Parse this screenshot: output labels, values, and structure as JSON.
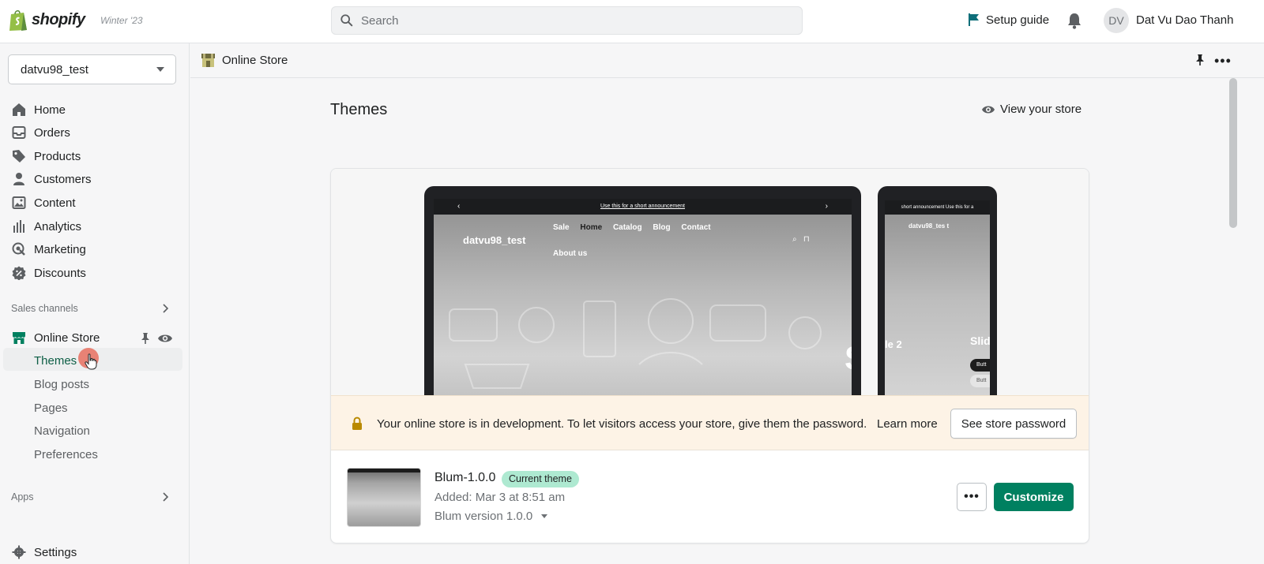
{
  "topbar": {
    "brand": "shopify",
    "edition": "Winter '23",
    "search_placeholder": "Search",
    "setup_guide": "Setup guide",
    "avatar_initials": "DV",
    "user_name": "Dat Vu Dao Thanh"
  },
  "sidebar": {
    "store": "datvu98_test",
    "items": [
      {
        "label": "Home",
        "icon": "home-icon"
      },
      {
        "label": "Orders",
        "icon": "orders-icon"
      },
      {
        "label": "Products",
        "icon": "tag-icon"
      },
      {
        "label": "Customers",
        "icon": "person-icon"
      },
      {
        "label": "Content",
        "icon": "image-icon"
      },
      {
        "label": "Analytics",
        "icon": "bars-icon"
      },
      {
        "label": "Marketing",
        "icon": "target-icon"
      },
      {
        "label": "Discounts",
        "icon": "discount-icon"
      }
    ],
    "sales_channels": "Sales channels",
    "online_store": "Online Store",
    "subitems": [
      "Themes",
      "Blog posts",
      "Pages",
      "Navigation",
      "Preferences"
    ],
    "apps": "Apps",
    "settings": "Settings"
  },
  "pagebar": {
    "title": "Online Store"
  },
  "main": {
    "title": "Themes",
    "view_store": "View your store"
  },
  "preview": {
    "announcement": "Use this for a short announcement",
    "site_name": "datvu98_test",
    "nav": [
      "Sale",
      "Home",
      "Catalog",
      "Blog",
      "Contact"
    ],
    "about": "About us",
    "big_letter": "S",
    "phone_announcement": "short announcement  Use this for a",
    "phone_site_name": "datvu98_tes t",
    "phone_text_left": "le 2",
    "phone_text_right": "Slid",
    "phone_btn1": "Butt",
    "phone_btn2": "Butt"
  },
  "banner": {
    "text": "Your online store is in development. To let visitors access your store, give them the password.",
    "learn_more": "Learn more",
    "password_button": "See store password",
    "accent": "#b98900"
  },
  "theme": {
    "name": "Blum-1.0.0",
    "badge": "Current theme",
    "added": "Added: Mar 3 at 8:51 am",
    "version": "Blum version 1.0.0",
    "more_label": "•••",
    "customize": "Customize",
    "customize_color": "#008060"
  }
}
